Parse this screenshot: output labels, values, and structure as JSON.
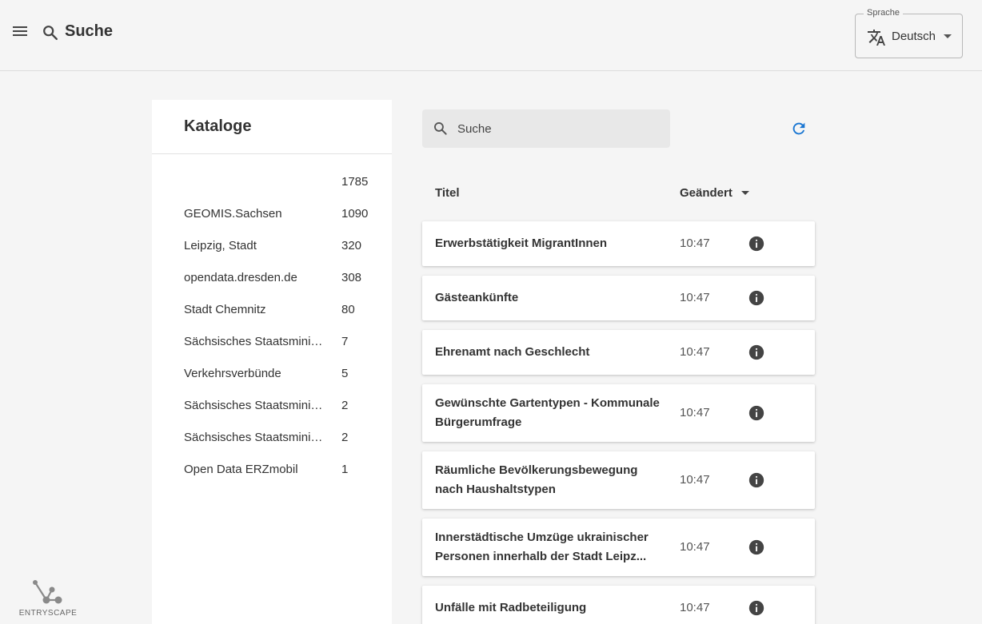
{
  "header": {
    "title": "Suche",
    "language": {
      "legend": "Sprache",
      "value": "Deutsch"
    }
  },
  "catalogs": {
    "title": "Kataloge",
    "items": [
      {
        "name": "",
        "count": "1785"
      },
      {
        "name": "GEOMIS.Sachsen",
        "count": "1090"
      },
      {
        "name": "Leipzig, Stadt",
        "count": "320"
      },
      {
        "name": "opendata.dresden.de",
        "count": "308"
      },
      {
        "name": "Stadt Chemnitz",
        "count": "80"
      },
      {
        "name": "Sächsisches Staatsministerium",
        "count": "7"
      },
      {
        "name": "Verkehrsverbünde",
        "count": "5"
      },
      {
        "name": "Sächsisches Staatsministerium",
        "count": "2"
      },
      {
        "name": "Sächsisches Staatsministerium",
        "count": "2"
      },
      {
        "name": "Open Data ERZmobil",
        "count": "1"
      }
    ]
  },
  "search": {
    "placeholder": "Suche"
  },
  "table": {
    "col_title": "Titel",
    "col_changed": "Geändert",
    "rows": [
      {
        "title": "Erwerbstätigkeit MigrantInnen",
        "time": "10:47"
      },
      {
        "title": "Gästeankünfte",
        "time": "10:47"
      },
      {
        "title": "Ehrenamt nach Geschlecht",
        "time": "10:47"
      },
      {
        "title": "Gewünschte Gartentypen - Kommunale Bürgerumfrage",
        "time": "10:47"
      },
      {
        "title": "Räumliche Bevölkerungsbewegung nach Haushaltstypen",
        "time": "10:47"
      },
      {
        "title": "Innerstädtische Umzüge ukrainischer Personen innerhalb der Stadt Leipz...",
        "time": "10:47"
      },
      {
        "title": "Unfälle mit Radbeteiligung",
        "time": "10:47"
      }
    ]
  },
  "logo": {
    "text": "ENTRYSCAPE"
  },
  "icons": {
    "menu": "menu-icon",
    "search": "search-icon",
    "translate": "translate-icon",
    "refresh": "refresh-icon",
    "info": "info-icon"
  },
  "colors": {
    "accent": "#1976d2",
    "info_icon": "#444444",
    "logo": "#8a8a8a"
  }
}
